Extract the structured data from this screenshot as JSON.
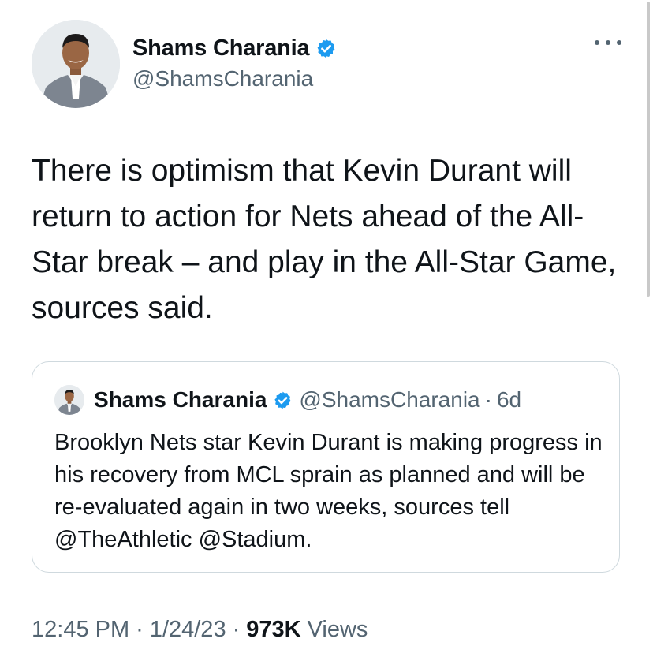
{
  "author": {
    "name": "Shams Charania",
    "handle": "@ShamsCharania"
  },
  "tweet": {
    "text": "There is optimism that Kevin Durant will return to action for Nets ahead of the All-Star break – and play in the All-Star Game, sources said."
  },
  "quoted_tweet": {
    "name": "Shams Charania",
    "handle": "@ShamsCharania",
    "separator": "·",
    "age": "6d",
    "text": "Brooklyn Nets star Kevin Durant is making progress in his recovery from MCL sprain as planned and will be re-evaluated again in two weeks, sources tell @TheAthletic @Stadium."
  },
  "meta": {
    "time": "12:45 PM",
    "separator1": "·",
    "date": "1/24/23",
    "separator2": "·",
    "views_count": "973K",
    "views_label": "Views"
  },
  "icons": {
    "verified": "verified-badge-icon",
    "more": "more-horizontal-icon"
  },
  "colors": {
    "verified_blue": "#1d9bf0",
    "text_primary": "#0f1419",
    "text_secondary": "#536471",
    "border": "#cfd9de"
  }
}
